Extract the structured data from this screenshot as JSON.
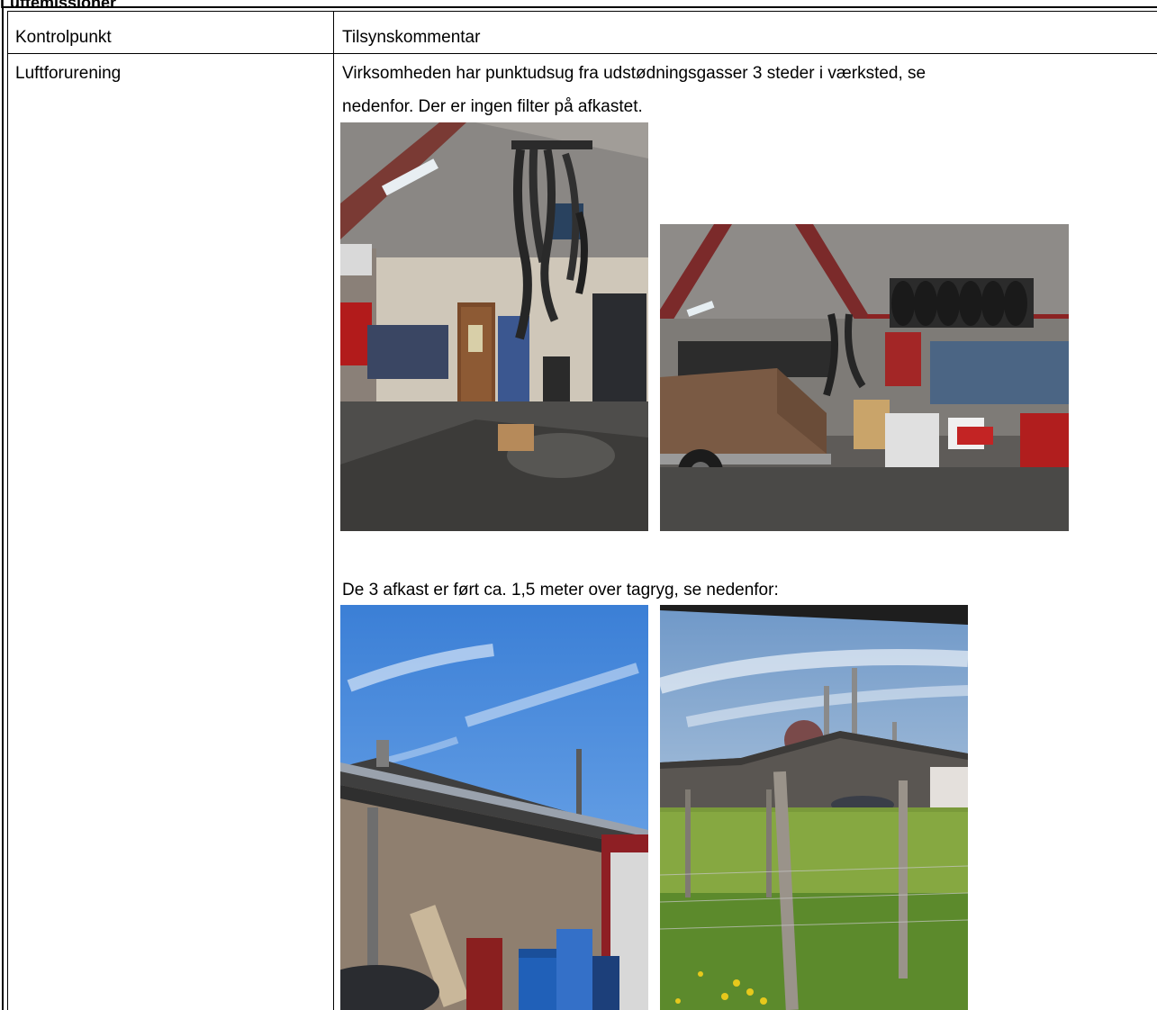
{
  "section": {
    "heading": "Luftemissioner"
  },
  "table": {
    "headers": {
      "col1": "Kontrolpunkt",
      "col2": "Tilsynskommentar"
    },
    "row": {
      "label": "Luftforurening",
      "comment_line1": "Virksomheden har punktudsug fra udstødningsgasser 3 steder i værksted, se",
      "comment_line2": "nedenfor. Der er ingen filter på afkastet.",
      "comment_line3": "De 3 afkast er ført ca. 1,5 meter over tagryg, se nedenfor:"
    }
  },
  "photos": [
    {
      "name": "workshop-interior-photo",
      "subject": "Workshop with hanging exhaust extraction hoses"
    },
    {
      "name": "workshop-trailer-photo",
      "subject": "Workshop with trailer, tyre rack and extraction hoses"
    },
    {
      "name": "building-exterior-photo",
      "subject": "Building exterior with exhaust stack above roof"
    },
    {
      "name": "roof-stacks-photo",
      "subject": "Three exhaust stacks above roof ridge seen over hedge"
    }
  ]
}
